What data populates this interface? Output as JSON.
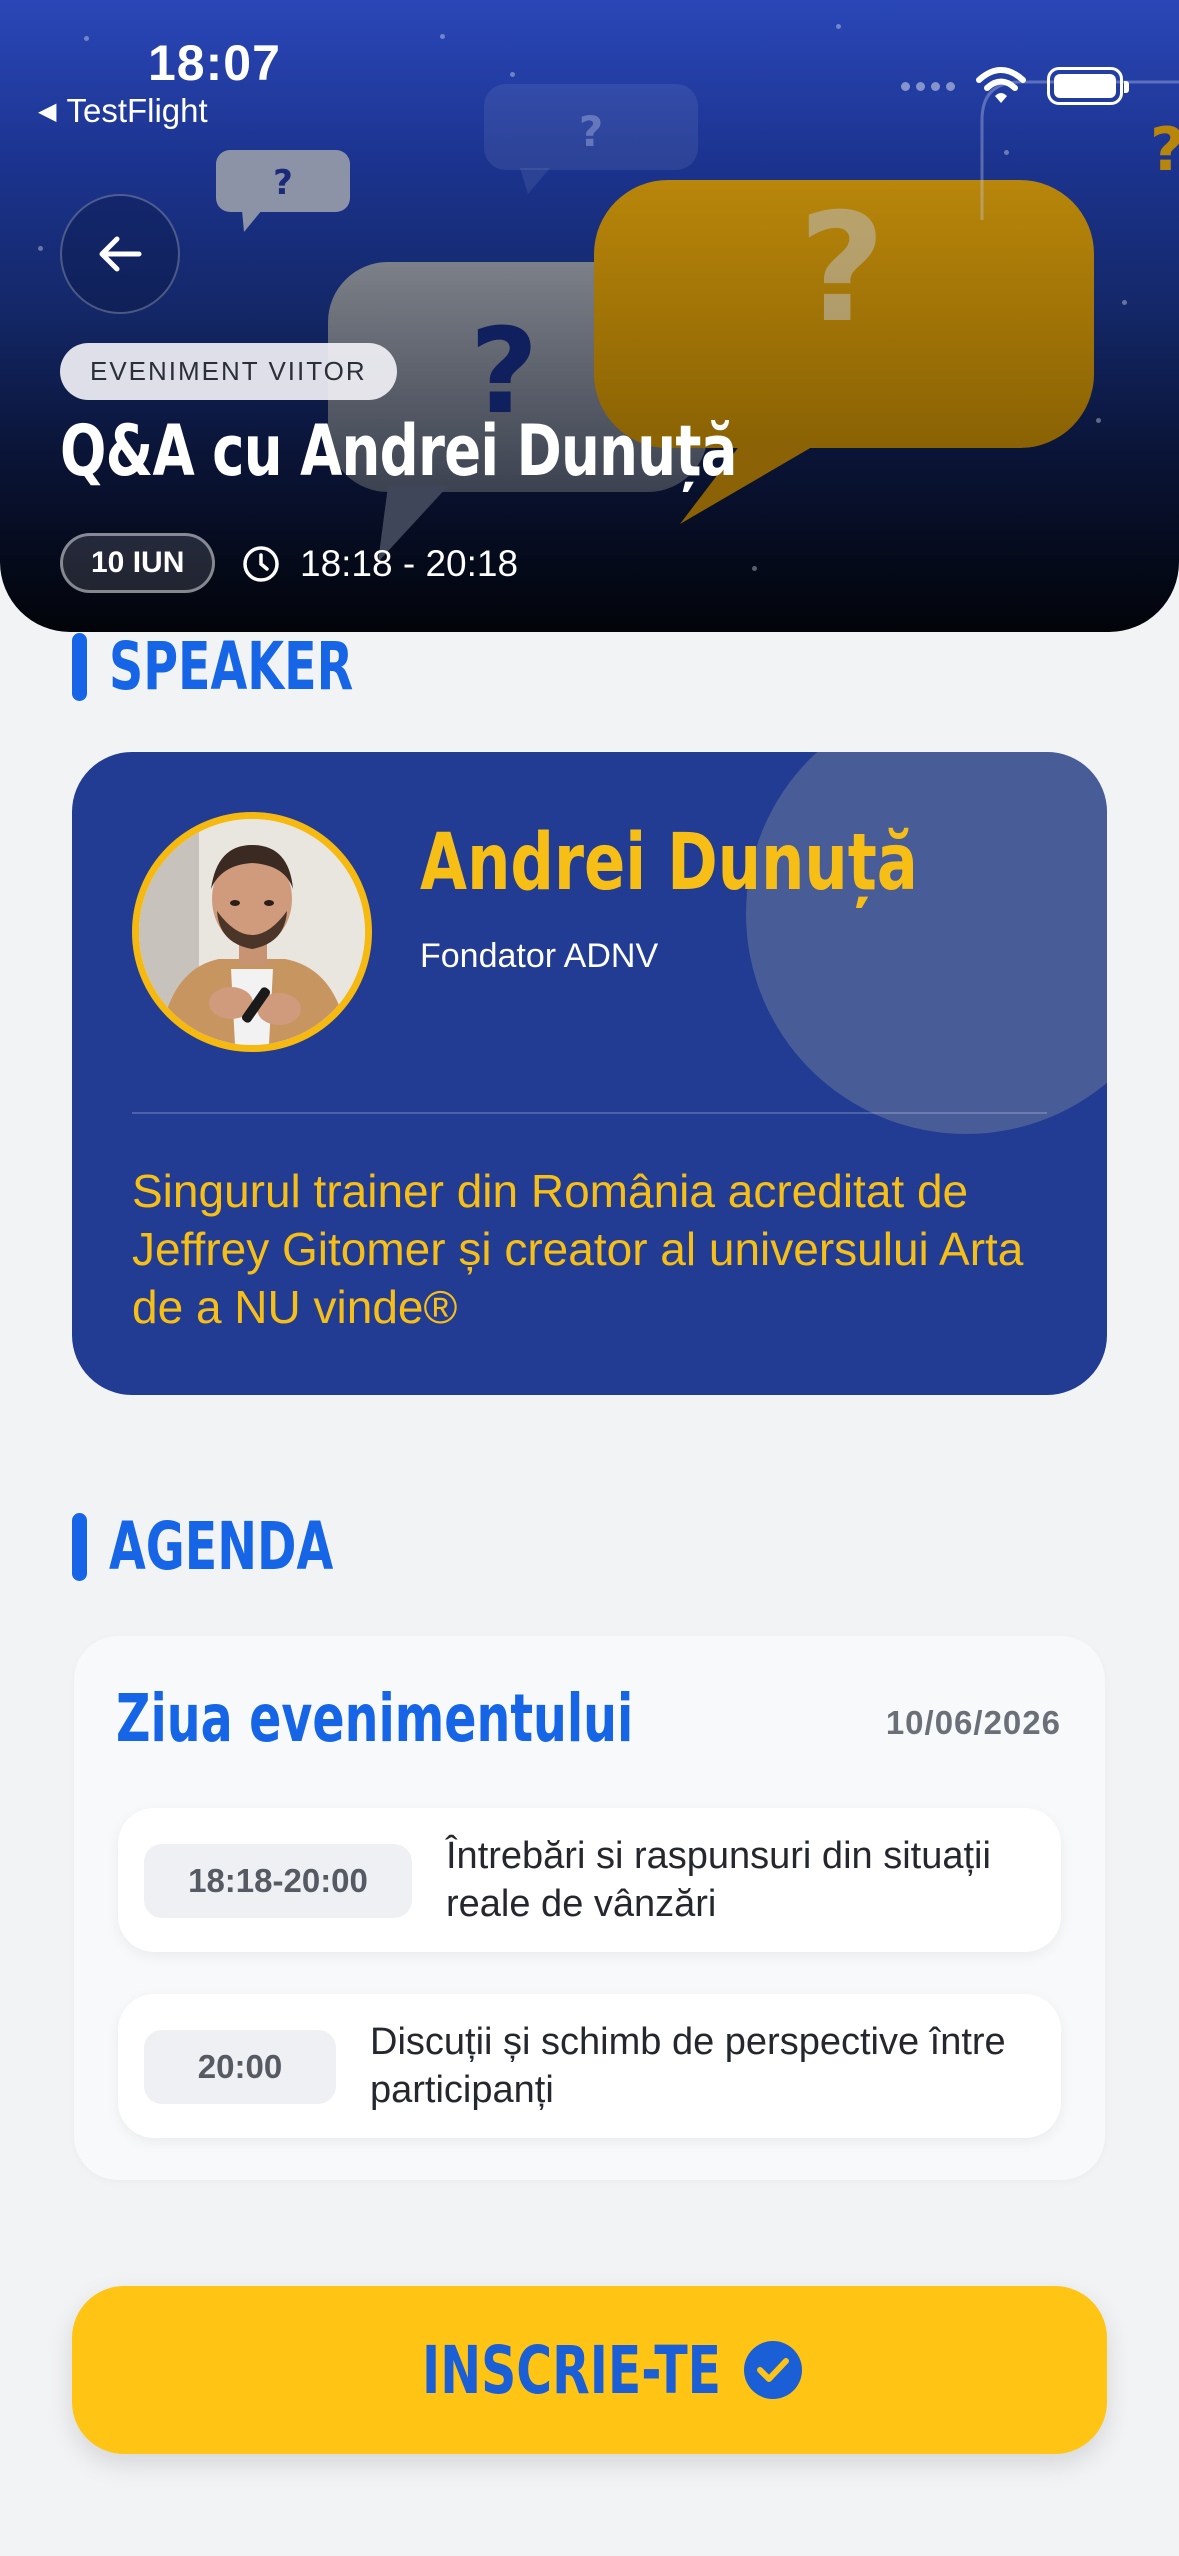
{
  "status_bar": {
    "time": "18:07",
    "back_app": "TestFlight"
  },
  "hero": {
    "badge": "EVENIMENT VIITOR",
    "title": "Q&A cu Andrei Dunuță",
    "date_chip": "10 IUN",
    "time_range": "18:18 - 20:18"
  },
  "speaker_section": {
    "heading": "SPEAKER",
    "name": "Andrei Dunuță",
    "role": "Fondator ADNV",
    "bio": "Singurul trainer din România acreditat de Jeffrey Gitomer și creator al universului Arta de a NU vinde®"
  },
  "agenda_section": {
    "heading": "AGENDA",
    "day_title": "Ziua evenimentului",
    "day_date": "10/06/2026",
    "items": [
      {
        "time": "18:18-20:00",
        "description": "Întrebări si raspunsuri din situații reale de vânzări"
      },
      {
        "time": "20:00",
        "description": "Discuții și schimb de perspective între participanți"
      }
    ]
  },
  "cta": {
    "label": "INSCRIE-TE"
  },
  "colors": {
    "brand_blue": "#1565e6",
    "accent_yellow": "#ffc414",
    "card_navy": "#213c92"
  },
  "icons": [
    "arrow-left-icon",
    "clock-icon",
    "wifi-icon",
    "battery-icon",
    "check-circle-icon"
  ]
}
